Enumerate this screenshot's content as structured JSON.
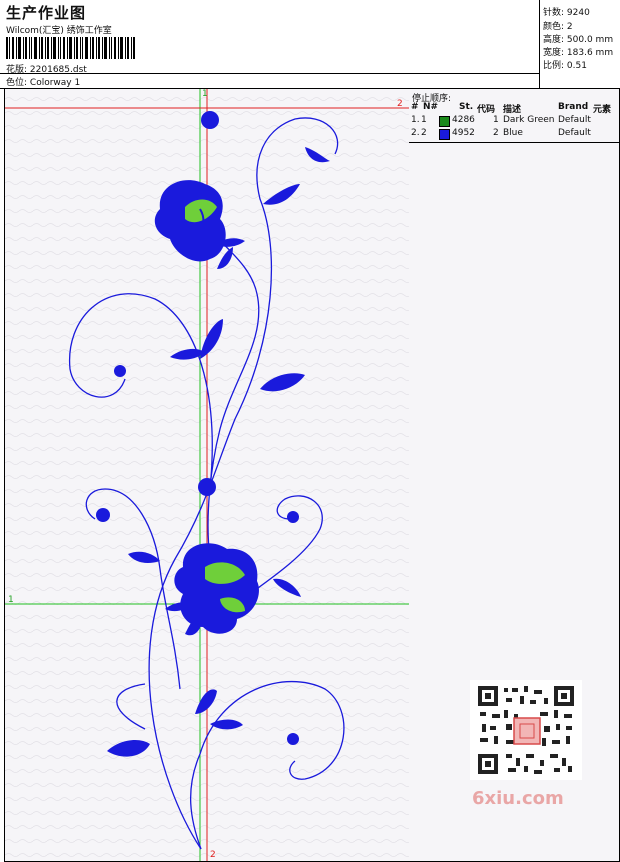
{
  "header": {
    "title": "生产作业图",
    "subtitle": "Wilcom(汇宝) 绣饰工作室",
    "design_label": "花版:",
    "design_value": "2201685.dst",
    "colorway_label": "色位:",
    "colorway_value": "Colorway 1"
  },
  "stats": {
    "stitches_label": "针数:",
    "stitches_value": "9240",
    "colors_label": "颜色:",
    "colors_value": "2",
    "height_label": "高度:",
    "height_value": "500.0 mm",
    "width_label": "宽度:",
    "width_value": "183.6 mm",
    "scale_label": "比例:",
    "scale_value": "0.51"
  },
  "canvas": {
    "marker_top": "1",
    "marker_right": "2",
    "marker_left": "1",
    "marker_bottom": "2"
  },
  "stop_sequence": {
    "heading": "停止顺序:",
    "columns": [
      "#",
      "N#",
      "St.",
      "代码",
      "描述",
      "Brand",
      "元素"
    ],
    "rows": [
      {
        "num": "1.",
        "n": "1",
        "st": "4286",
        "code": "1",
        "desc": "Dark Green",
        "brand": "Default",
        "color": "#1a8a1a"
      },
      {
        "num": "2.",
        "n": "2",
        "st": "4952",
        "code": "2",
        "desc": "Blue",
        "brand": "Default",
        "color": "#1a1adc"
      }
    ]
  },
  "watermark": {
    "text": "6xiu.com"
  },
  "colors": {
    "thread_blue": "#1a1adc",
    "thread_green": "#6fcf3a",
    "guide_red": "#e02020",
    "guide_green": "#20c020"
  }
}
